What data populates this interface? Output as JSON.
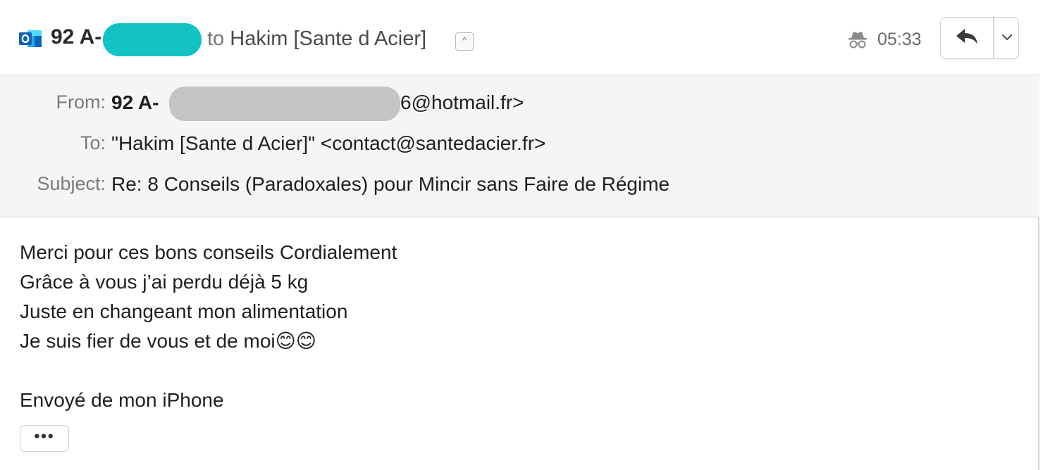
{
  "header": {
    "sender_visible": "92 A-",
    "to_prefix": "to",
    "recipient_name": "Hakim [Sante d Acier]",
    "collapse_glyph": "^",
    "time": "05:33",
    "icons": [
      "outlook-icon",
      "incognito-icon",
      "reply-icon",
      "chevron-down-icon"
    ],
    "redaction_color": "#12c2c4"
  },
  "fields": {
    "from_label": "From:",
    "from_name_visible": "92 A-",
    "from_email_tail": "6@hotmail.fr>",
    "to_label": "To:",
    "to_value": "\"Hakim [Sante d Acier]\" <contact@santedacier.fr>",
    "subject_label": "Subject:",
    "subject_value": "Re: 8 Conseils (Paradoxales) pour Mincir sans Faire de Régime"
  },
  "message": {
    "lines": [
      "Merci pour ces bons conseils Cordialement",
      "Grâce à vous j’ai perdu déjà 5 kg",
      "Juste en changeant mon alimentation",
      "Je suis fier de vous et de moi😊😊"
    ],
    "signature": "Envoyé de mon iPhone",
    "expand_label": "•••"
  }
}
